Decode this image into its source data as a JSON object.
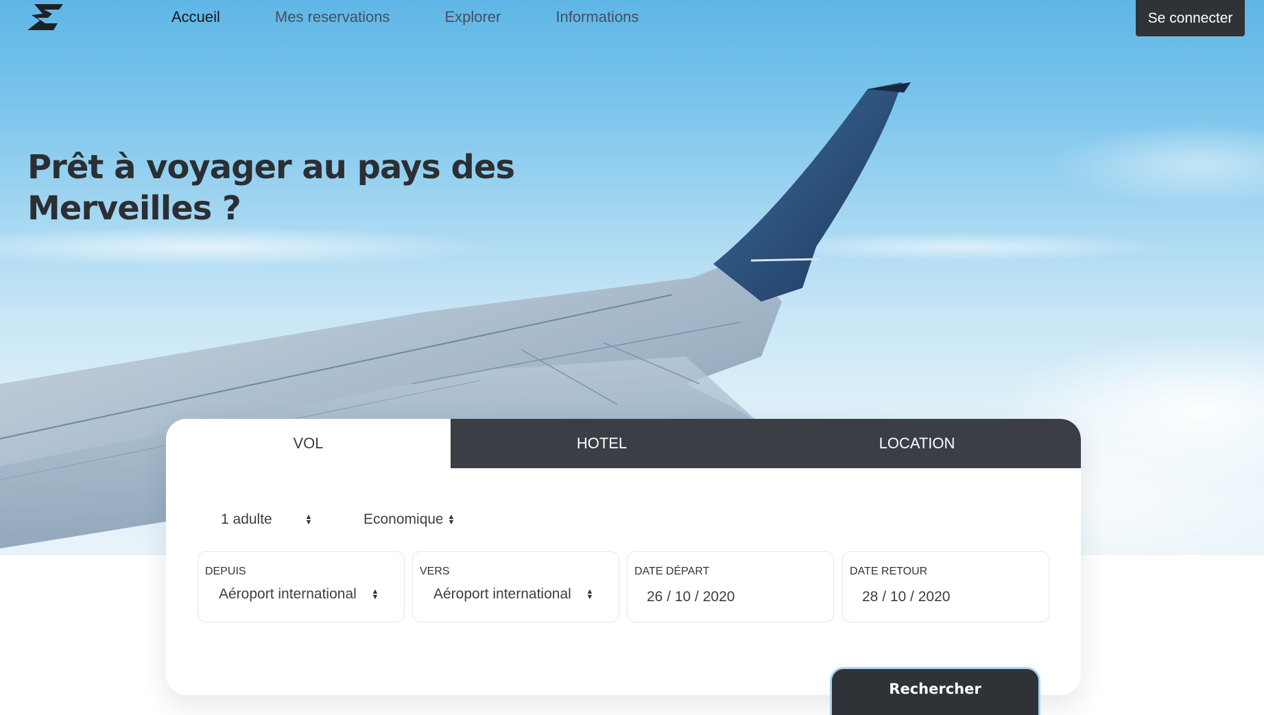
{
  "nav": {
    "logo_icon": "zigzag-z-logo-icon",
    "links": [
      "Accueil",
      "Mes reservations",
      "Explorer",
      "Informations"
    ],
    "active": "Accueil",
    "login_label": "Se connecter"
  },
  "hero": {
    "headline": "Prêt à voyager au pays des Merveilles ?",
    "image": "airplane-wing-over-clouds"
  },
  "booking": {
    "tabs": [
      "VOL",
      "HOTEL",
      "LOCATION"
    ],
    "active_tab": "VOL",
    "passengers": "1 adulte",
    "cabin_class": "Economique",
    "from": {
      "label": "DEPUIS",
      "value": "Aéroport international"
    },
    "to": {
      "label": "VERS",
      "value": "Aéroport international"
    },
    "departure": {
      "label": "DATE DÉPART",
      "value": "26 / 10 / 2020"
    },
    "return": {
      "label": "DATE RETOUR",
      "value": "28 / 10 / 2020"
    },
    "search_label": "Rechercher"
  },
  "colors": {
    "dark": "#2f3338",
    "tab_inactive": "#3b3f45",
    "sky": "#79c4ec",
    "focus_ring": "#a9d4f2"
  }
}
